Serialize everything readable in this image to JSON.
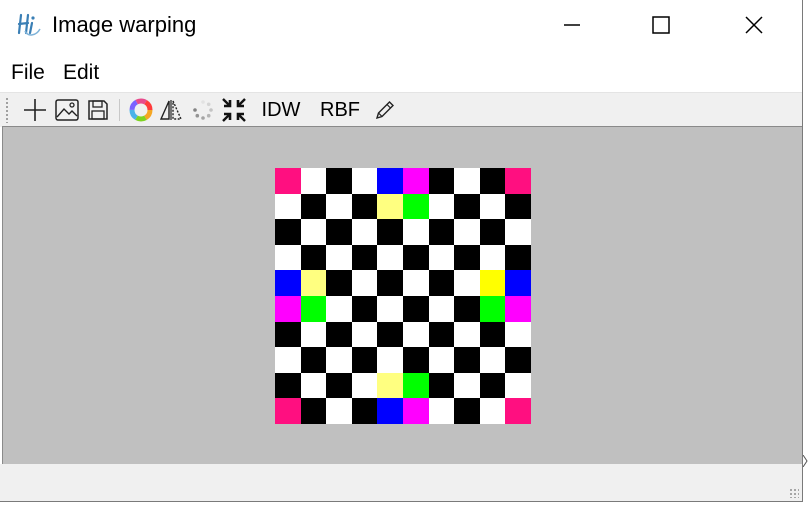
{
  "window": {
    "title": "Image warping",
    "app_icon": "qt-hi-logo-icon"
  },
  "window_controls": {
    "minimize": "minimize-icon",
    "maximize": "maximize-icon",
    "close": "close-icon"
  },
  "menubar": {
    "items": [
      "File",
      "Edit"
    ]
  },
  "toolbar": {
    "icons": [
      "new-icon",
      "open-image-icon",
      "save-icon",
      "color-wheel-icon",
      "mirror-icon",
      "loading-icon",
      "fit-icon"
    ],
    "idw_label": "IDW",
    "rbf_label": "RBF",
    "pencil_icon": "pencil-icon"
  },
  "image": {
    "rows": 10,
    "cols": 10,
    "cells": [
      [
        "#ff0f80",
        "#ffffff",
        "#000000",
        "#ffffff",
        "#0000ff",
        "#ff00ff",
        "#000000",
        "#ffffff",
        "#000000",
        "#ff0f80"
      ],
      [
        "#ffffff",
        "#000000",
        "#ffffff",
        "#000000",
        "#ffff80",
        "#00ff00",
        "#ffffff",
        "#000000",
        "#ffffff",
        "#000000"
      ],
      [
        "#000000",
        "#ffffff",
        "#000000",
        "#ffffff",
        "#000000",
        "#ffffff",
        "#000000",
        "#ffffff",
        "#000000",
        "#ffffff"
      ],
      [
        "#ffffff",
        "#000000",
        "#ffffff",
        "#000000",
        "#ffffff",
        "#000000",
        "#ffffff",
        "#000000",
        "#ffffff",
        "#000000"
      ],
      [
        "#0000ff",
        "#ffff80",
        "#000000",
        "#ffffff",
        "#000000",
        "#ffffff",
        "#000000",
        "#ffffff",
        "#ffff00",
        "#0000ff"
      ],
      [
        "#ff00ff",
        "#00ff00",
        "#ffffff",
        "#000000",
        "#ffffff",
        "#000000",
        "#ffffff",
        "#000000",
        "#00ff00",
        "#ff00ff"
      ],
      [
        "#000000",
        "#ffffff",
        "#000000",
        "#ffffff",
        "#000000",
        "#ffffff",
        "#000000",
        "#ffffff",
        "#000000",
        "#ffffff"
      ],
      [
        "#ffffff",
        "#000000",
        "#ffffff",
        "#000000",
        "#ffffff",
        "#000000",
        "#ffffff",
        "#000000",
        "#ffffff",
        "#000000"
      ],
      [
        "#000000",
        "#ffffff",
        "#000000",
        "#ffffff",
        "#ffff80",
        "#00ff00",
        "#000000",
        "#ffffff",
        "#000000",
        "#ffffff"
      ],
      [
        "#ff0f80",
        "#000000",
        "#ffffff",
        "#000000",
        "#0000ff",
        "#ff00ff",
        "#ffffff",
        "#000000",
        "#ffffff",
        "#ff0f80"
      ]
    ]
  },
  "colors": {
    "canvas_bg": "#c0c0c0",
    "toolbar_bg": "#f0f0f0",
    "status_bg": "#f0f0f0"
  }
}
